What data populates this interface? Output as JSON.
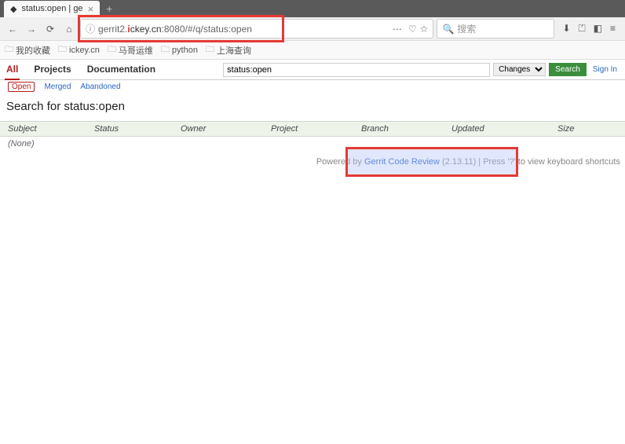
{
  "browser": {
    "tab_title": "status:open | ge",
    "url_prefix": "gerrit2.",
    "url_accent": "i",
    "url_host": "ckey.cn",
    "url_path": ":8080/#/q/status:open",
    "search_placeholder": "搜索"
  },
  "bookmarks": {
    "items": [
      "我的收藏",
      "ickey.cn",
      "马哥运维",
      "python",
      "上海查询"
    ]
  },
  "gerrit": {
    "tabs": [
      "All",
      "Projects",
      "Documentation"
    ],
    "search_value": "status:open",
    "changes_label": "Changes",
    "search_btn": "Search",
    "signin": "Sign In",
    "subtabs": [
      "Open",
      "Merged",
      "Abandoned"
    ],
    "search_title": "Search for status:open",
    "columns": {
      "subject": "Subject",
      "status": "Status",
      "owner": "Owner",
      "project": "Project",
      "branch": "Branch",
      "updated": "Updated",
      "size": "Size"
    },
    "none_row": "(None)",
    "footer": {
      "powered_by": "Powered by ",
      "link_text": "Gerrit Code Review",
      "version": " (2.13.11) ",
      "shortcut_hint": "| Press '?' to view keyboard shortcuts"
    }
  }
}
